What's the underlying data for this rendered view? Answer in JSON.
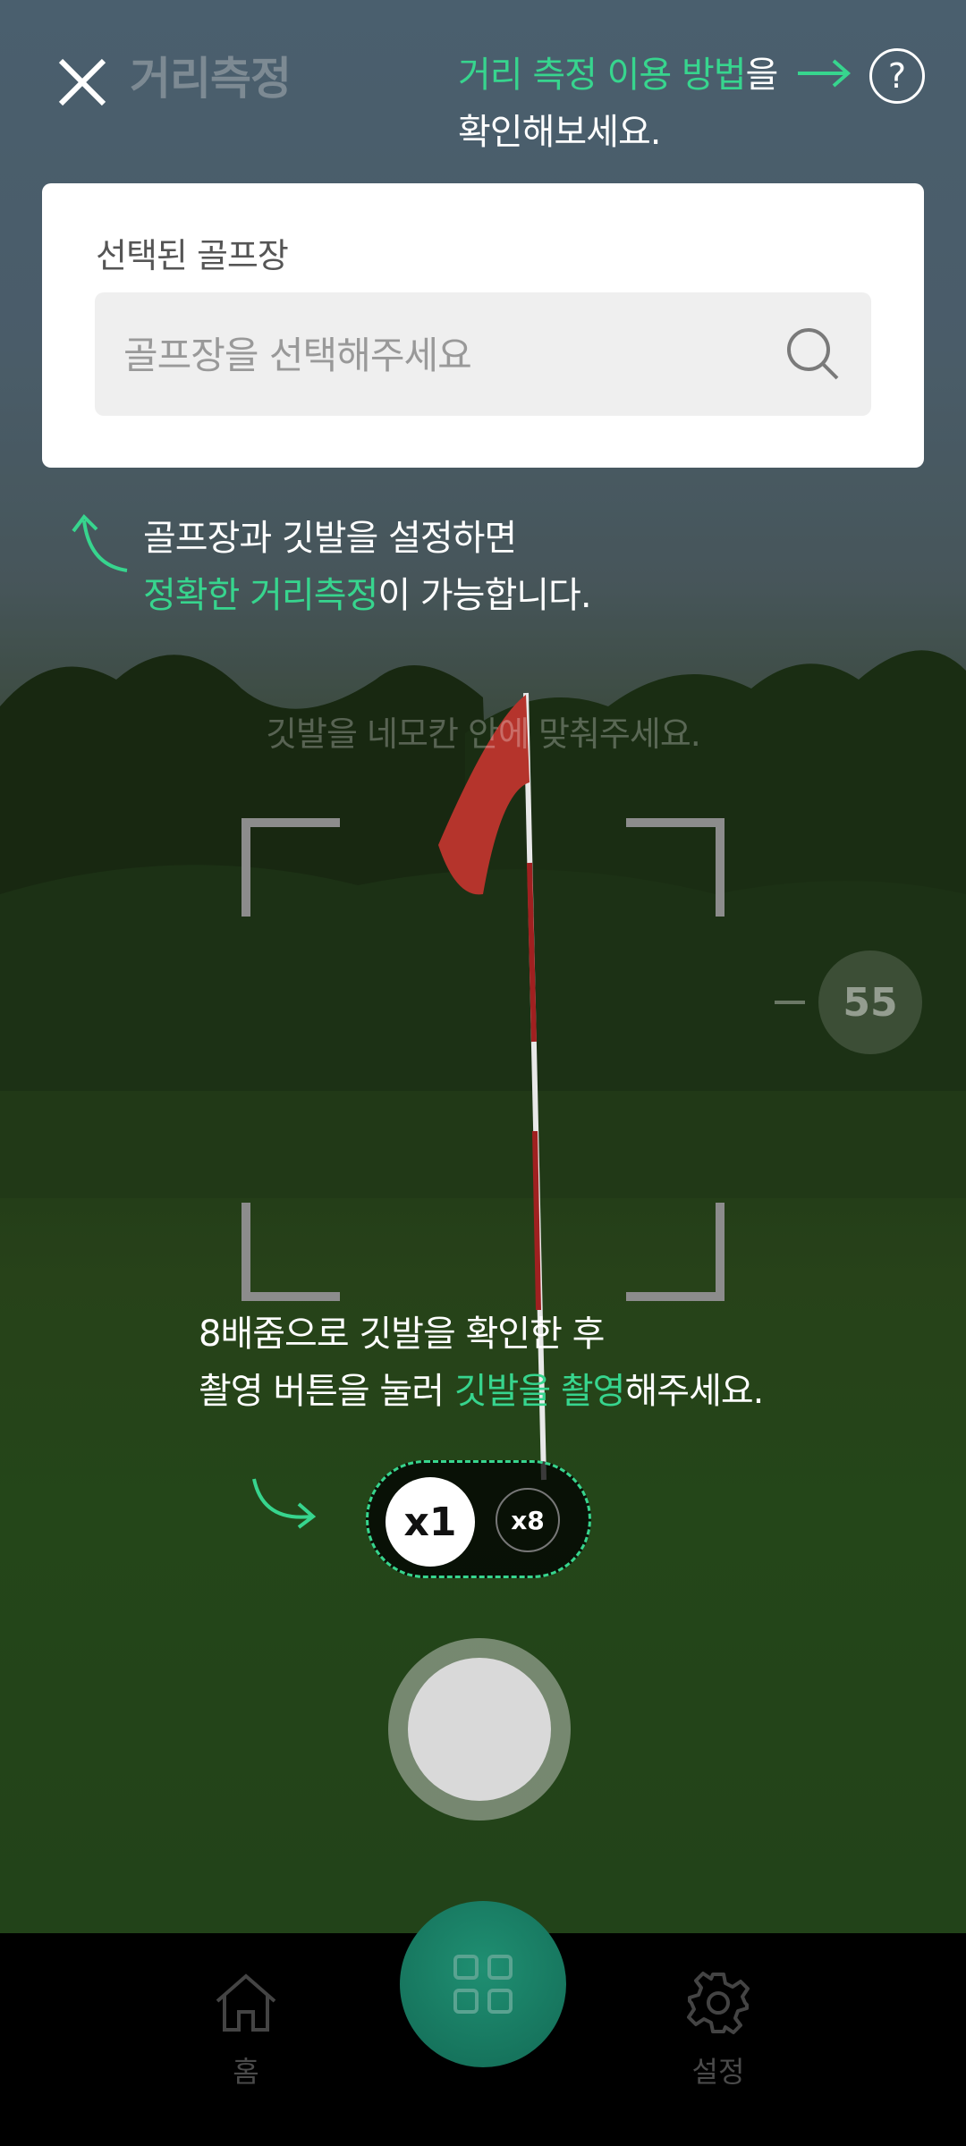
{
  "header": {
    "title": "거리측정",
    "help_hint_highlight": "거리 측정 이용 방법",
    "help_hint_rest": "을",
    "help_hint_line2": "확인해보세요.",
    "help_button": "?"
  },
  "course_card": {
    "label": "선택된 골프장",
    "search_placeholder": "골프장을 선택해주세요"
  },
  "hint_setup": {
    "line1": "골프장과 깃발을 설정하면",
    "line2_highlight": "정확한 거리측정",
    "line2_rest": "이 가능합니다."
  },
  "frame_hint": "깃발을 네모칸 안에 맞춰주세요.",
  "zoom_level_display": "55",
  "hint_capture": {
    "line1": "8배줌으로 깃발을 확인한 후",
    "line2_prefix": "촬영 버튼을 눌러 ",
    "line2_highlight": "깃발을 촬영",
    "line2_suffix": "해주세요."
  },
  "zoom_toggle": {
    "x1": "x1",
    "x8": "x8",
    "selected": "x1"
  },
  "bottom_nav": {
    "home_label": "홈",
    "settings_label": "설정"
  },
  "colors": {
    "accent": "#37d58e",
    "center_button": "#177a62"
  },
  "icons": [
    "close-icon",
    "arrow-right-icon",
    "help-icon",
    "search-icon",
    "curved-arrow-up-icon",
    "curved-arrow-right-icon",
    "home-icon",
    "grid-icon",
    "gear-icon"
  ]
}
